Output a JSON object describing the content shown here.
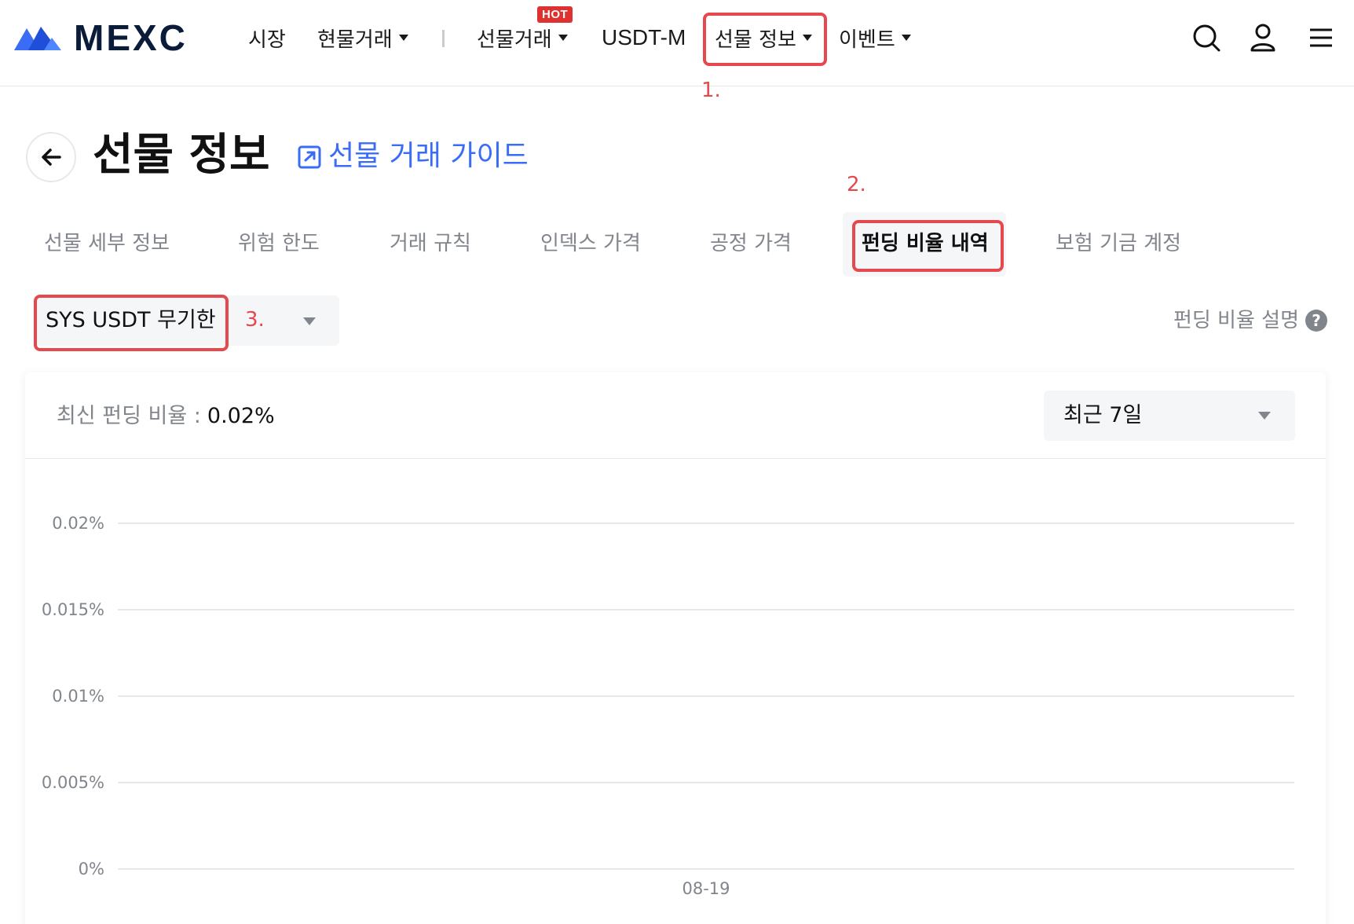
{
  "brand": {
    "name": "MEXC",
    "accent": "#3b6cf6",
    "highlight": "#e5484d"
  },
  "nav": {
    "market": "시장",
    "spot": "현물거래",
    "futures": "선물거래",
    "hot_badge": "HOT",
    "usdt_m": "USDT-M",
    "futures_info": "선물 정보",
    "events": "이벤트"
  },
  "header_icons": [
    "search-icon",
    "user-icon",
    "menu-icon"
  ],
  "steps": {
    "one": "1.",
    "two": "2.",
    "three": "3."
  },
  "page": {
    "title": "선물 정보",
    "guide_link": "선물 거래 가이드"
  },
  "tabs": [
    {
      "label": "선물 세부 정보",
      "active": false
    },
    {
      "label": "위험 한도",
      "active": false
    },
    {
      "label": "거래 규칙",
      "active": false
    },
    {
      "label": "인덱스 가격",
      "active": false
    },
    {
      "label": "공정 가격",
      "active": false
    },
    {
      "label": "펀딩 비율 내역",
      "active": true
    },
    {
      "label": "보험 기금 계정",
      "active": false
    }
  ],
  "selector": {
    "value": "SYS USDT 무기한"
  },
  "funding_explain": "펀딩 비율 설명",
  "latest": {
    "label": "최신 펀딩 비율 :",
    "value": "0.02%"
  },
  "range": {
    "value": "최근 7일"
  },
  "chart_data": {
    "type": "line",
    "y_ticks": [
      "0.02%",
      "0.015%",
      "0.01%",
      "0.005%",
      "0%"
    ],
    "x_ticks": [
      "08-19"
    ],
    "ylim": [
      0,
      0.02
    ],
    "grid": true,
    "series": []
  }
}
